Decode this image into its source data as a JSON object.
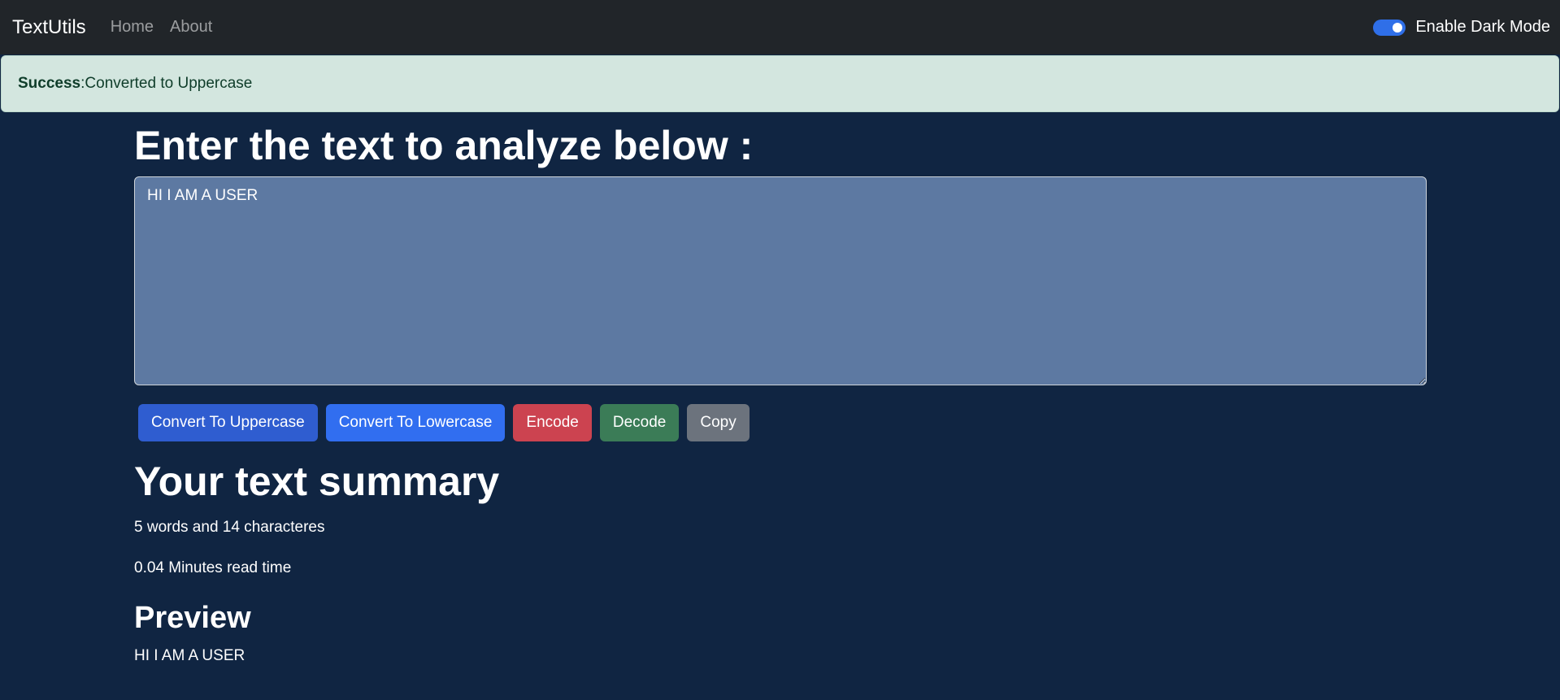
{
  "navbar": {
    "brand": "TextUtils",
    "links": [
      "Home",
      "About"
    ],
    "dark_mode_label": "Enable Dark Mode",
    "dark_mode_enabled": true
  },
  "alert": {
    "type": "Success",
    "message": ":Converted to Uppercase"
  },
  "form": {
    "heading": "Enter the text to analyze below :",
    "text_value": "HI I AM A USER",
    "buttons": [
      "Convert To Uppercase",
      "Convert To Lowercase",
      "Encode",
      "Decode",
      "Copy"
    ]
  },
  "summary": {
    "heading": "Your text summary",
    "counts": "5 words and 14 characteres",
    "read_time": "0.04 Minutes read time"
  },
  "preview": {
    "heading": "Preview",
    "text": "HI I AM A USER"
  },
  "colors": {
    "page_bg": "#102542",
    "navbar_bg": "#212529",
    "alert_bg": "#d3e6df",
    "textarea_bg": "#5d79a2",
    "uppercase_button": "#2f5dd0",
    "lowercase_button": "#316ef0",
    "encode_button": "#cc4350",
    "decode_button": "#3b7c57",
    "copy_button": "#6c737d"
  }
}
